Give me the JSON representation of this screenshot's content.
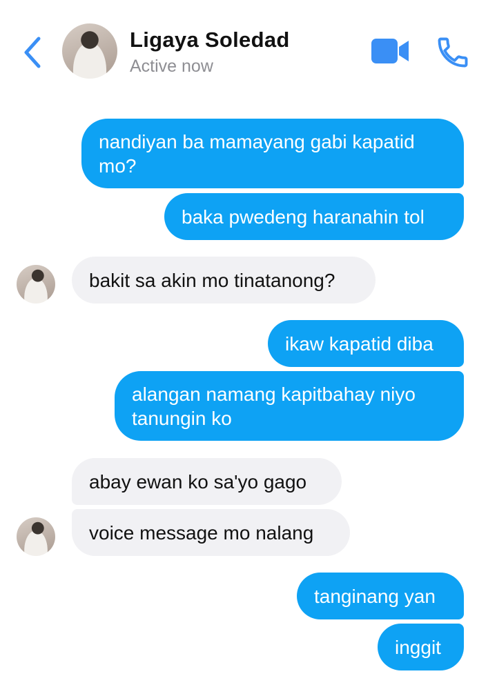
{
  "header": {
    "contact_name": "Ligaya Soledad",
    "status": "Active now"
  },
  "messages": [
    {
      "sender": "me",
      "text": "nandiyan ba mamayang gabi kapatid\nmo?"
    },
    {
      "sender": "me",
      "text": "baka pwedeng haranahin tol"
    },
    {
      "sender": "contact",
      "text": "bakit sa akin mo tinatanong?"
    },
    {
      "sender": "me",
      "text": "ikaw kapatid diba"
    },
    {
      "sender": "me",
      "text": "alangan namang kapitbahay niyo\ntanungin ko"
    },
    {
      "sender": "contact",
      "text": "abay ewan ko sa'yo gago"
    },
    {
      "sender": "contact",
      "text": "voice message mo nalang"
    },
    {
      "sender": "me",
      "text": "tanginang yan"
    },
    {
      "sender": "me",
      "text": "inggit"
    }
  ],
  "colors": {
    "accent": "#0ea2f4",
    "icon_blue": "#3a8ff5",
    "incoming_bubble": "#f1f1f4",
    "status_gray": "#8e8e93"
  },
  "icons": [
    "back-chevron-icon",
    "video-call-icon",
    "phone-call-icon"
  ]
}
